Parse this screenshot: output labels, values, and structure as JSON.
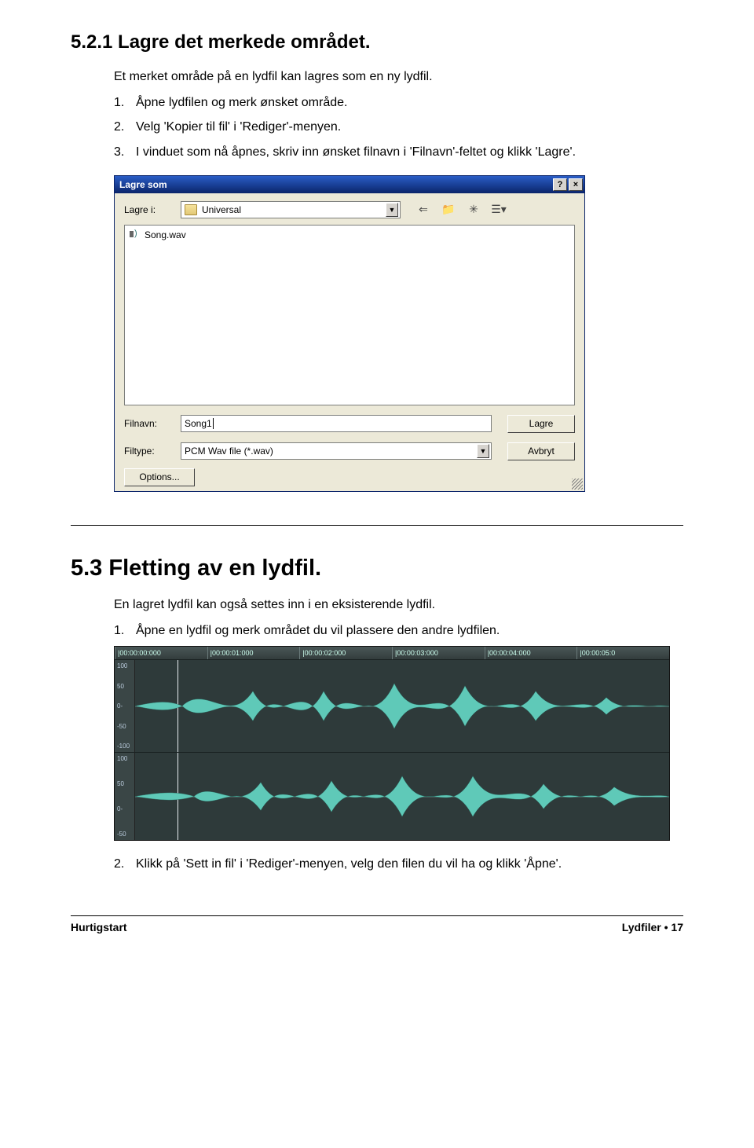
{
  "headings": {
    "h521": "5.2.1  Lagre det merkede området.",
    "h53": "5.3  Fletting av en lydfil."
  },
  "section521": {
    "intro": "Et merket område på en lydfil kan lagres som en ny lydfil.",
    "steps": [
      "Åpne lydfilen og merk ønsket område.",
      "Velg 'Kopier til fil' i 'Rediger'-menyen.",
      "I vinduet som nå åpnes, skriv inn ønsket filnavn i 'Filnavn'-feltet og klikk 'Lagre'."
    ]
  },
  "dialog": {
    "title": "Lagre som",
    "help_btn": "?",
    "close_btn": "×",
    "lookin_label": "Lagre i:",
    "lookin_value": "Universal",
    "file_item": "Song.wav",
    "filename_label": "Filnavn:",
    "filename_value": "Song1",
    "filetype_label": "Filtype:",
    "filetype_value": "PCM Wav file (*.wav)",
    "save_btn": "Lagre",
    "cancel_btn": "Avbryt",
    "options_btn": "Options..."
  },
  "section53": {
    "intro": "En lagret lydfil kan også settes inn i en eksisterende lydfil.",
    "steps": [
      "Åpne en lydfil og merk området du vil plassere den andre lydfilen.",
      "Klikk på 'Sett in fil' i 'Rediger'-menyen, velg den filen du vil ha og klikk 'Åpne'."
    ]
  },
  "waveform": {
    "ruler": [
      "|00:00:00:000",
      "|00:00:01:000",
      "|00:00:02:000",
      "|00:00:03:000",
      "|00:00:04:000",
      "|00:00:05:0"
    ],
    "axis_top": [
      "100",
      "50",
      "0-",
      "-50",
      "-100"
    ],
    "axis_bottom": [
      "100",
      "50",
      "0-",
      "-50"
    ]
  },
  "footer": {
    "left": "Hurtigstart",
    "right_label": "Lydfiler",
    "bullet": "•",
    "page": "17"
  }
}
